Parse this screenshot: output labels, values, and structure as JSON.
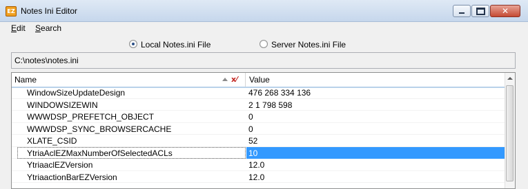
{
  "window": {
    "title": "Notes Ini Editor",
    "icon_text": "EZ"
  },
  "menu": {
    "edit_prefix": "",
    "edit_underline": "E",
    "edit_rest": "dit",
    "search_underline": "S",
    "search_rest": "earch"
  },
  "source": {
    "local_label": "Local Notes.ini File",
    "server_label": "Server Notes.ini File",
    "selected": "local"
  },
  "path": "C:\\notes\\notes.ini",
  "grid": {
    "columns": [
      "Name",
      "Value"
    ],
    "sort_indicator": "ascending",
    "filter_icon_glyph": "x⁄",
    "rows": [
      {
        "name": "WindowSizeUpdateDesign",
        "value": "476 268 334 136"
      },
      {
        "name": "WINDOWSIZEWIN",
        "value": "2 1 798 598"
      },
      {
        "name": "WWWDSP_PREFETCH_OBJECT",
        "value": "0"
      },
      {
        "name": "WWWDSP_SYNC_BROWSERCACHE",
        "value": "0"
      },
      {
        "name": "XLATE_CSID",
        "value": "52"
      },
      {
        "name": "YtriaAclEZMaxNumberOfSelectedACLs",
        "value": "10"
      },
      {
        "name": "YtriaaclEZVersion",
        "value": "12.0"
      },
      {
        "name": "YtriaactionBarEZVersion",
        "value": "12.0"
      }
    ],
    "focused_row_index": 5
  },
  "colors": {
    "selection": "#3399ff",
    "titlebar": "#c6d7ec"
  }
}
